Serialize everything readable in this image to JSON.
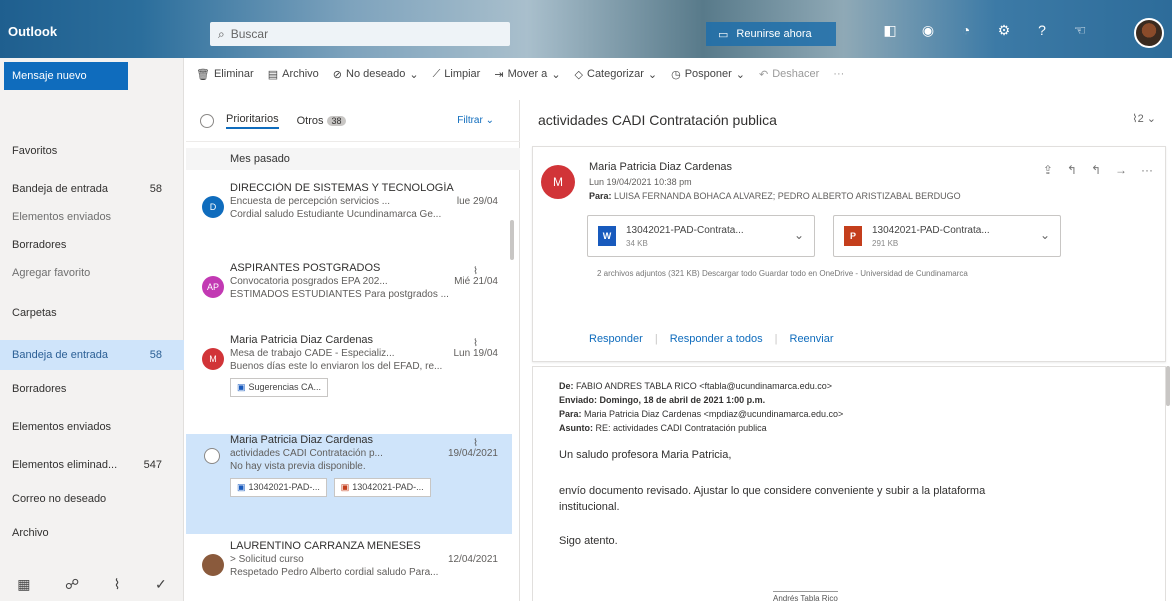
{
  "topbar": {
    "app_name": "Outlook",
    "search_placeholder": "Buscar",
    "meet_label": "Reunirse ahora"
  },
  "nav": {
    "new_message": "Mensaje nuevo",
    "favorites_title": "Favoritos",
    "favorites": [
      {
        "label": "Bandeja de entrada",
        "count": "58"
      },
      {
        "label": "Elementos enviados",
        "count": ""
      },
      {
        "label": "Borradores",
        "count": ""
      },
      {
        "label": "Agregar favorito",
        "count": ""
      }
    ],
    "folders_title": "Carpetas",
    "folders": [
      {
        "label": "Bandeja de entrada",
        "count": "58"
      },
      {
        "label": "Borradores",
        "count": ""
      },
      {
        "label": "Elementos enviados",
        "count": ""
      },
      {
        "label": "Elementos eliminad...",
        "count": "547"
      },
      {
        "label": "Correo no deseado",
        "count": ""
      },
      {
        "label": "Archivo",
        "count": ""
      }
    ]
  },
  "toolbar": {
    "delete": "Eliminar",
    "archive": "Archivo",
    "junk": "No deseado",
    "sweep": "Limpiar",
    "move": "Mover a",
    "categorize": "Categorizar",
    "snooze": "Posponer",
    "undo": "Deshacer",
    "more": "···"
  },
  "list": {
    "tab_focused": "Prioritarios",
    "tab_other": "Otros",
    "other_badge": "38",
    "filter": "Filtrar",
    "group": "Mes pasado",
    "messages": [
      {
        "initial": "D",
        "sender": "DIRECCIÓN DE SISTEMAS Y TECNOLOGÍA",
        "subject": "Encuesta de percepción servicios ...",
        "date": "lue 29/04",
        "preview": "Cordial saludo Estudiante Ucundinamarca Ge..."
      },
      {
        "initial": "AP",
        "sender": "ASPIRANTES POSTGRADOS",
        "subject": "Convocatoria posgrados EPA 202...",
        "date": "Mié 21/04",
        "preview": "ESTIMADOS ESTUDIANTES Para postgrados ..."
      },
      {
        "initial": "M",
        "sender": "Maria Patricia Diaz Cardenas",
        "subject": "Mesa de trabajo CADE - Especializ...",
        "date": "Lun 19/04",
        "preview": "Buenos días este lo enviaron los del EFAD, re...",
        "attachment": "Sugerencias CA..."
      },
      {
        "initial": "",
        "sender": "Maria Patricia Diaz Cardenas",
        "subject": "actividades CADI Contratación p...",
        "date": "19/04/2021",
        "preview": "No hay vista previa disponible.",
        "attachment1": "13042021-PAD-...",
        "attachment2": "13042021-PAD-..."
      },
      {
        "initial": "",
        "sender": "LAURENTINO CARRANZA MENESES",
        "subject": "> Solicitud curso",
        "date": "12/04/2021",
        "preview": "Respetado Pedro Alberto cordial saludo Para..."
      }
    ]
  },
  "reading": {
    "subject": "actividades CADI Contratación publica",
    "page_badge": "2",
    "sender_initial": "M",
    "from": "Maria Patricia Diaz Cardenas",
    "date": "Lun 19/04/2021 10:38 pm",
    "to_label": "Para:",
    "to": "LUISA FERNANDA BOHACA ALVAREZ; PEDRO ALBERTO ARISTIZABAL BERDUGO",
    "attachments": [
      {
        "name": "13042021-PAD-Contrata...",
        "size": "34 KB"
      },
      {
        "name": "13042021-PAD-Contrata...",
        "size": "291 KB"
      }
    ],
    "attach_info": "2 archivos adjuntos (321 KB)    Descargar todo    Guardar todo en OneDrive - Universidad de Cundinamarca",
    "reply": "Responder",
    "reply_all": "Responder a todos",
    "forward": "Reenviar",
    "hdr_from_label": "De:",
    "hdr_from": "FABIO ANDRES TABLA RICO <ftabla@ucundinamarca.edu.co>",
    "hdr_sent_label": "Enviado:",
    "hdr_sent": "Domingo, 18 de abril de 2021 1:00 p.m.",
    "hdr_to_label": "Para:",
    "hdr_to": "Maria Patricia Diaz Cardenas <mpdiaz@ucundinamarca.edu.co>",
    "hdr_subject_label": "Asunto:",
    "hdr_subject": "RE: actividades CADI Contratación publica",
    "greeting": "Un saludo profesora Maria Patricia,",
    "body1": "envío documento revisado. Ajustar lo que considere conveniente y subir a la plataforma",
    "body2": "institucional.",
    "closing": "Sigo atento.",
    "signature": "Andrés Tabla Rico"
  },
  "colors": {
    "accent": "#0f6cbd",
    "selected": "#cfe4fa",
    "avatar_red": "#d13438"
  }
}
